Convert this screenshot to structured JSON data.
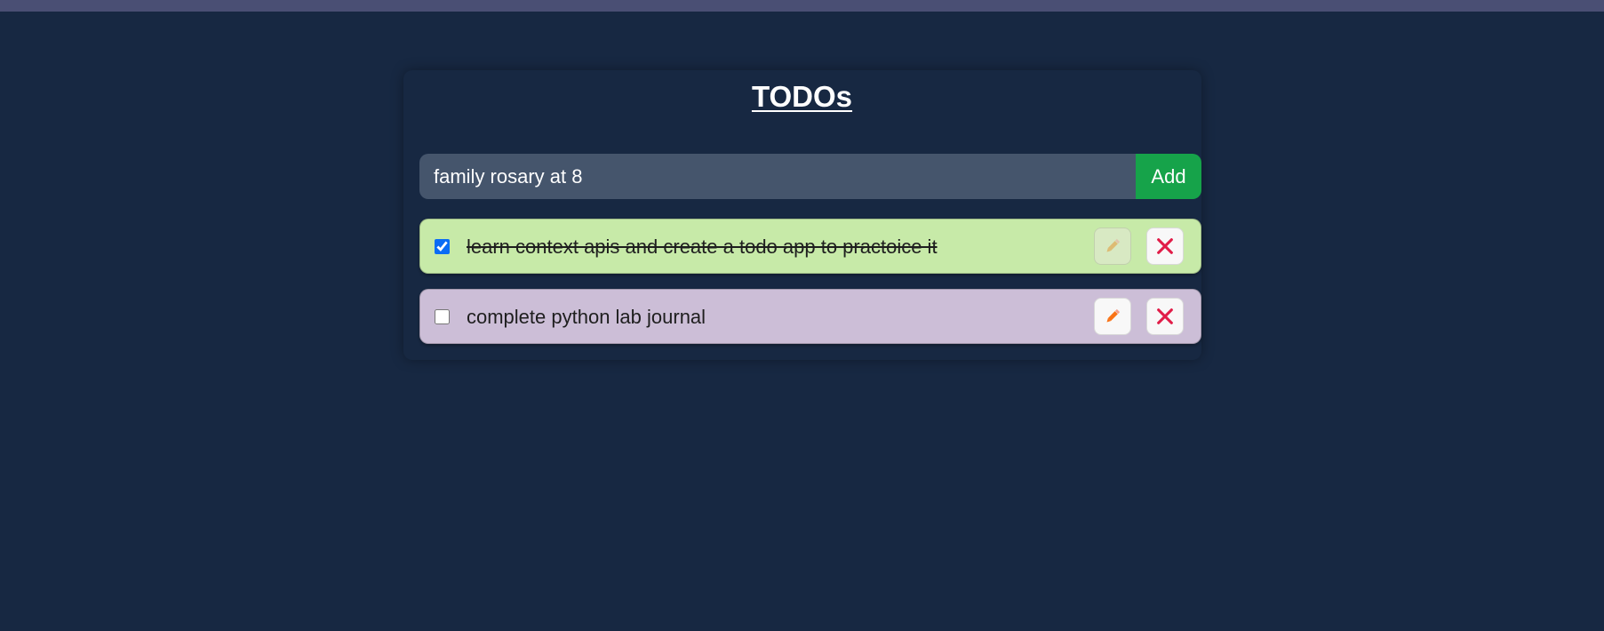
{
  "app": {
    "title": "TODOs"
  },
  "form": {
    "input_value": "family rosary at 8",
    "add_label": "Add"
  },
  "todos": [
    {
      "text": "learn context apis and create a todo app to practoice it",
      "completed": true
    },
    {
      "text": "complete python lab journal",
      "completed": false
    }
  ],
  "icons": {
    "edit": "pencil-icon",
    "delete": "close-icon"
  },
  "colors": {
    "background": "#172842",
    "input_bg": "#45556c",
    "add_button": "#16a34a",
    "completed_item": "#c7eaa8",
    "pending_item": "#ccbed7",
    "pencil": "#f97316",
    "close": "#e11d48"
  }
}
